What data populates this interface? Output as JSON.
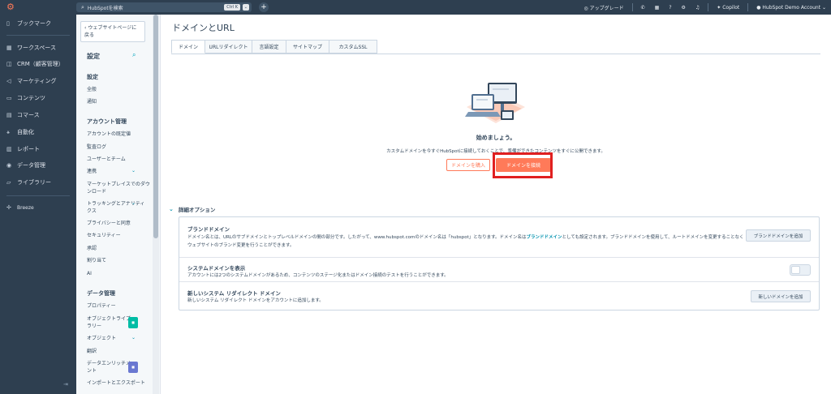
{
  "topbar": {
    "search_placeholder": "HubSpotを検索",
    "shortcut": "Ctrl K",
    "upgrade": "アップグレード",
    "copilot": "Copilot",
    "account": "HubSpot Demo Account"
  },
  "nav": {
    "items": [
      {
        "label": "ブックマーク",
        "icon": "bookmark-icon"
      },
      {
        "label": "ワークスペース",
        "icon": "grid-icon"
      },
      {
        "label": "CRM（顧客管理）",
        "icon": "crm-icon"
      },
      {
        "label": "マーケティング",
        "icon": "megaphone-icon"
      },
      {
        "label": "コンテンツ",
        "icon": "content-icon"
      },
      {
        "label": "コマース",
        "icon": "commerce-icon"
      },
      {
        "label": "自動化",
        "icon": "automation-icon"
      },
      {
        "label": "レポート",
        "icon": "chart-icon"
      },
      {
        "label": "データ管理",
        "icon": "database-icon"
      },
      {
        "label": "ライブラリー",
        "icon": "folder-icon"
      },
      {
        "label": "Breeze",
        "icon": "breeze-icon"
      }
    ]
  },
  "sidebar": {
    "back_label": "ウェブサイトページに戻る",
    "title": "設定",
    "sections": [
      {
        "heading": "設定",
        "items": [
          "全般",
          "通知"
        ]
      },
      {
        "heading": "アカウント管理",
        "items": [
          "アカウントの既定値",
          "監査ログ",
          "ユーザーとチーム",
          "連携",
          "マーケットプレイスでのダウンロード",
          "トラッキングとアナリティクス",
          "プライバシーと同意",
          "セキュリティー",
          "承認",
          "割り当て",
          "AI"
        ]
      },
      {
        "heading": "データ管理",
        "items": [
          "プロパティー",
          "オブジェクトライブラリー",
          "オブジェクト",
          "翻訳",
          "データエンリッチメント",
          "インポートとエクスポート"
        ]
      }
    ]
  },
  "main": {
    "title": "ドメインとURL",
    "tabs": [
      "ドメイン",
      "URLリダイレクト",
      "言語設定",
      "サイトマップ",
      "カスタムSSL"
    ],
    "empty_state": {
      "heading": "始めましょう。",
      "description": "カスタムドメインを今すぐHubSpotに接続しておくことで、準備ができたコンテンツをすぐに公開できます。",
      "buy_button": "ドメインを購入",
      "connect_button": "ドメインを接続"
    },
    "advanced_label": "詳細オプション",
    "rows": {
      "brand": {
        "title": "ブランドドメイン",
        "desc_1": "ドメイン名とは、URLのサブドメインとトップレベルドメインの間の部分です。したがって、www.hubspot.comのドメイン名は「hubspot」となります。ドメイン名は",
        "desc_link": "ブランドドメイン",
        "desc_2": "としても設定されます。ブランドドメインを使用して、ルートドメインを変更することなくウェブサイトのブランド変更を行うことができます。",
        "button": "ブランドドメインを追加"
      },
      "system": {
        "title": "システムドメインを表示",
        "desc": "アカウントには2つのシステムドメインがあるため、コンテンツのステージ化またはドメイン接続のテストを行うことができます。"
      },
      "redirect": {
        "title": "新しいシステム リダイレクト ドメイン",
        "desc": "新しいシステム リダイレクト ドメインをアカウントに追加します。",
        "button": "新しいドメインを追加"
      }
    }
  },
  "colors": {
    "nav_bg": "#2e3f50",
    "accent": "#ff7a59",
    "highlight": "#e02020",
    "link": "#0091ae"
  }
}
